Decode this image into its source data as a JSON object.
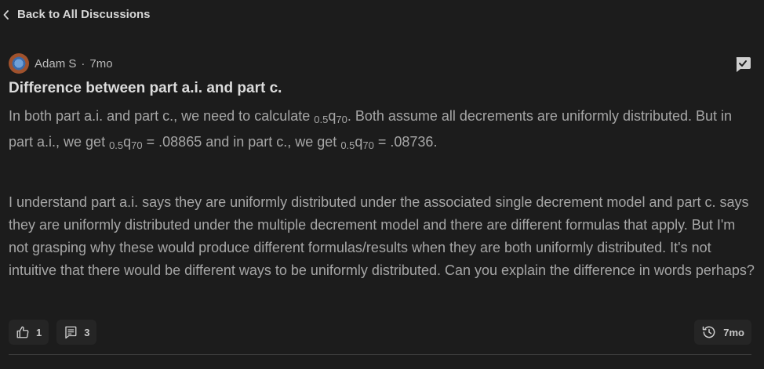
{
  "nav": {
    "back_label": "Back to All Discussions"
  },
  "post": {
    "author": "Adam S",
    "separator": "·",
    "age": "7mo",
    "title": "Difference between part a.i. and part c.",
    "para1_a": "In both part a.i. and part c., we need to calculate ",
    "sub_pre": "0.5",
    "q": "q",
    "sub_post": "70",
    "para1_b": ". Both assume all decrements are uniformly distributed. But in part a.i., we get ",
    "para1_c": " = .08865 and in part c., we get ",
    "para1_d": " = .08736.",
    "para2": "I understand part a.i. says they are uniformly distributed under the associated single decrement model and part c. says they are uniformly distributed under the multiple decrement model and there are different formulas that apply. But I'm not grasping why these would produce different formulas/results when they are both uniformly distributed. It's not intuitive that there would be different ways to be uniformly distributed. Can you explain the difference in words perhaps?"
  },
  "actions": {
    "likes": "1",
    "comments": "3",
    "time": "7mo"
  },
  "icons": {
    "back": "chevron-left-icon",
    "flag": "message-alert-icon",
    "like": "thumbs-up-icon",
    "comments": "comment-icon",
    "history": "history-clock-icon"
  }
}
